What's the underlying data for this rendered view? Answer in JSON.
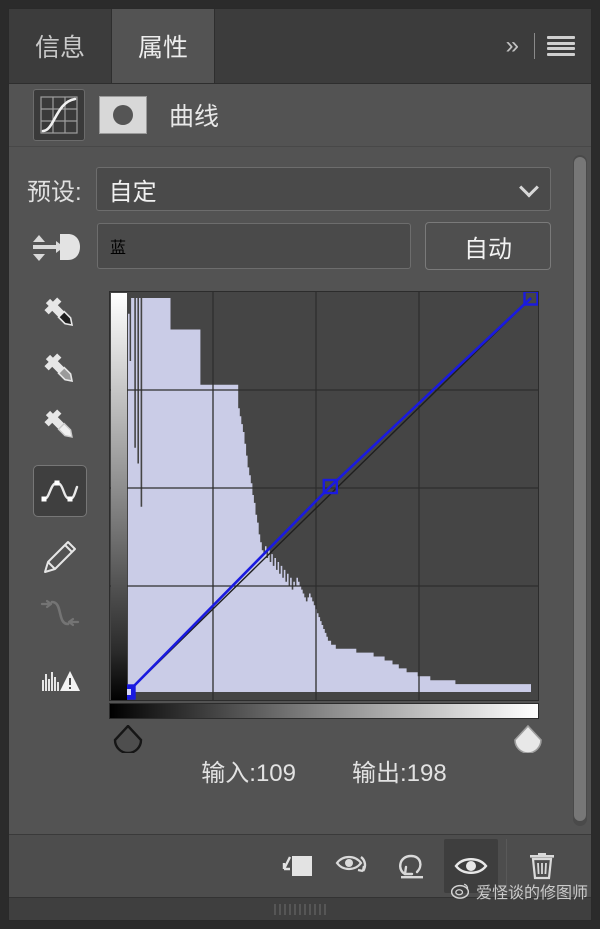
{
  "window": {
    "app": "Photoshop",
    "panel_title": "属性"
  },
  "tabs": [
    {
      "label": "信息",
      "active": false,
      "name": "tab-info"
    },
    {
      "label": "属性",
      "active": true,
      "name": "tab-properties"
    }
  ],
  "header": {
    "collapse_icon": "double-chevron-right-icon",
    "menu_icon": "hamburger-menu-icon",
    "adjustment_icon": "curves-adjustment-icon",
    "mask_icon": "layer-mask-thumbnail-icon",
    "adjustment_title": "曲线"
  },
  "preset": {
    "label": "预设:",
    "value": "自定",
    "caret_icon": "chevron-down-icon"
  },
  "channel": {
    "targeted_adjust_icon": "targeted-adjustment-tool-icon",
    "value": "蓝",
    "caret_icon": "chevron-down-icon",
    "auto_label": "自动"
  },
  "tools": [
    {
      "name": "black-point-eyedropper-icon",
      "label": "设置黑场",
      "active": false,
      "disabled": false
    },
    {
      "name": "gray-point-eyedropper-icon",
      "label": "设置灰场",
      "active": false,
      "disabled": false
    },
    {
      "name": "white-point-eyedropper-icon",
      "label": "设置白场",
      "active": false,
      "disabled": false
    },
    {
      "name": "curve-point-tool-icon",
      "label": "编辑点以修改曲线",
      "active": true,
      "disabled": false
    },
    {
      "name": "pencil-tool-icon",
      "label": "通过绘制来修改曲线",
      "active": false,
      "disabled": false
    },
    {
      "name": "smooth-curve-icon",
      "label": "平滑曲线值",
      "active": false,
      "disabled": true
    },
    {
      "name": "histogram-warning-icon",
      "label": "高光剪切警告",
      "active": false,
      "disabled": false
    }
  ],
  "readout": {
    "input_label": "输入:",
    "input_value": "109",
    "output_label": "输出:",
    "output_value": "198"
  },
  "sliders": {
    "black_point_icon": "black-point-slider-icon",
    "white_point_icon": "white-point-slider-icon"
  },
  "bottom_toolbar": [
    {
      "name": "clip-to-layer-button",
      "icon": "clip-to-layer-icon",
      "active": false
    },
    {
      "name": "view-previous-state-button",
      "icon": "eye-previous-state-icon",
      "active": false
    },
    {
      "name": "reset-adjustment-button",
      "icon": "reset-arrow-icon",
      "active": false
    },
    {
      "name": "toggle-layer-visibility-button",
      "icon": "eye-icon",
      "active": true
    },
    {
      "name": "delete-adjustment-button",
      "icon": "trash-icon",
      "active": false
    }
  ],
  "scrollbar": {
    "name": "vertical-scrollbar"
  },
  "resize_grip": {
    "name": "panel-resize-grip"
  },
  "watermark": {
    "icon": "weibo-logo-icon",
    "text": "爱怪谈的修图师"
  },
  "colors": {
    "panel_bg": "#535353",
    "tabbar_bg": "#3c3c3c",
    "active_tab_bg": "#535353",
    "graph_bg": "#454545",
    "curve_stroke": "#1a1ae0",
    "histogram_fill": "#d6d8f5",
    "grid_line": "#2e2e2e",
    "text": "#e8e8e8"
  },
  "chart_data": {
    "type": "line",
    "title": "曲线 (Curves) — 蓝 通道",
    "xlabel": "输入",
    "ylabel": "输出",
    "xlim": [
      0,
      255
    ],
    "ylim": [
      0,
      255
    ],
    "grid": true,
    "grid_divisions": 4,
    "legend": "none",
    "series": [
      {
        "name": "baseline-diagonal",
        "type": "reference",
        "color": "#1f1f1f",
        "points": [
          [
            0,
            0
          ],
          [
            255,
            255
          ]
        ]
      },
      {
        "name": "blue-channel-curve",
        "type": "curve",
        "color": "#1a1ae0",
        "points": [
          [
            0,
            0
          ],
          [
            128,
            133
          ],
          [
            255,
            255
          ]
        ],
        "control_points": [
          {
            "input": 0,
            "output": 0,
            "selected": true
          },
          {
            "input": 128,
            "output": 133,
            "selected": false
          },
          {
            "input": 255,
            "output": 255,
            "selected": false
          }
        ]
      }
    ],
    "selected_point": {
      "input": 109,
      "output": 198
    },
    "histogram": {
      "name": "blue-channel-histogram",
      "color": "#d6d8f5",
      "bins": [
        96,
        84,
        100,
        100,
        62,
        100,
        58,
        100,
        47,
        100,
        100,
        100,
        100,
        100,
        100,
        100,
        100,
        100,
        100,
        100,
        100,
        100,
        100,
        100,
        100,
        100,
        100,
        92,
        92,
        92,
        92,
        92,
        92,
        92,
        92,
        92,
        92,
        92,
        92,
        92,
        92,
        92,
        92,
        92,
        92,
        92,
        78,
        78,
        78,
        78,
        78,
        78,
        78,
        78,
        78,
        78,
        78,
        78,
        78,
        78,
        78,
        78,
        78,
        78,
        78,
        78,
        78,
        78,
        78,
        78,
        72,
        70,
        68,
        66,
        63,
        60,
        57,
        55,
        53,
        50,
        48,
        45,
        43,
        40,
        38,
        36,
        35,
        37,
        34,
        36,
        33,
        35,
        32,
        34,
        31,
        33,
        30,
        32,
        29,
        31,
        28,
        30,
        27,
        29,
        26,
        28,
        27,
        29,
        28,
        27,
        26,
        25,
        24,
        23,
        24,
        25,
        24,
        23,
        22,
        21,
        20,
        19,
        18,
        17,
        16,
        15,
        14,
        13,
        13,
        12,
        12,
        12,
        11,
        11,
        11,
        11,
        11,
        11,
        11,
        11,
        11,
        11,
        11,
        11,
        11,
        10,
        10,
        10,
        10,
        10,
        10,
        10,
        10,
        10,
        10,
        10,
        9,
        9,
        9,
        9,
        9,
        9,
        9,
        8,
        8,
        8,
        8,
        8,
        7,
        7,
        7,
        7,
        6,
        6,
        6,
        6,
        6,
        5,
        5,
        5,
        5,
        5,
        5,
        5,
        4,
        4,
        4,
        4,
        4,
        4,
        4,
        4,
        3,
        3,
        3,
        3,
        3,
        3,
        3,
        3,
        3,
        3,
        3,
        3,
        3,
        3,
        3,
        3,
        2,
        2,
        2,
        2,
        2,
        2,
        2,
        2,
        2,
        2,
        2,
        2,
        2,
        2,
        2,
        2,
        2,
        2,
        2,
        2,
        2,
        2,
        2,
        2,
        2,
        2,
        2,
        2,
        2,
        2,
        2,
        2,
        2,
        2,
        2,
        2,
        2,
        2,
        2,
        2,
        2,
        2,
        2,
        2,
        2,
        2,
        2,
        2
      ]
    }
  }
}
